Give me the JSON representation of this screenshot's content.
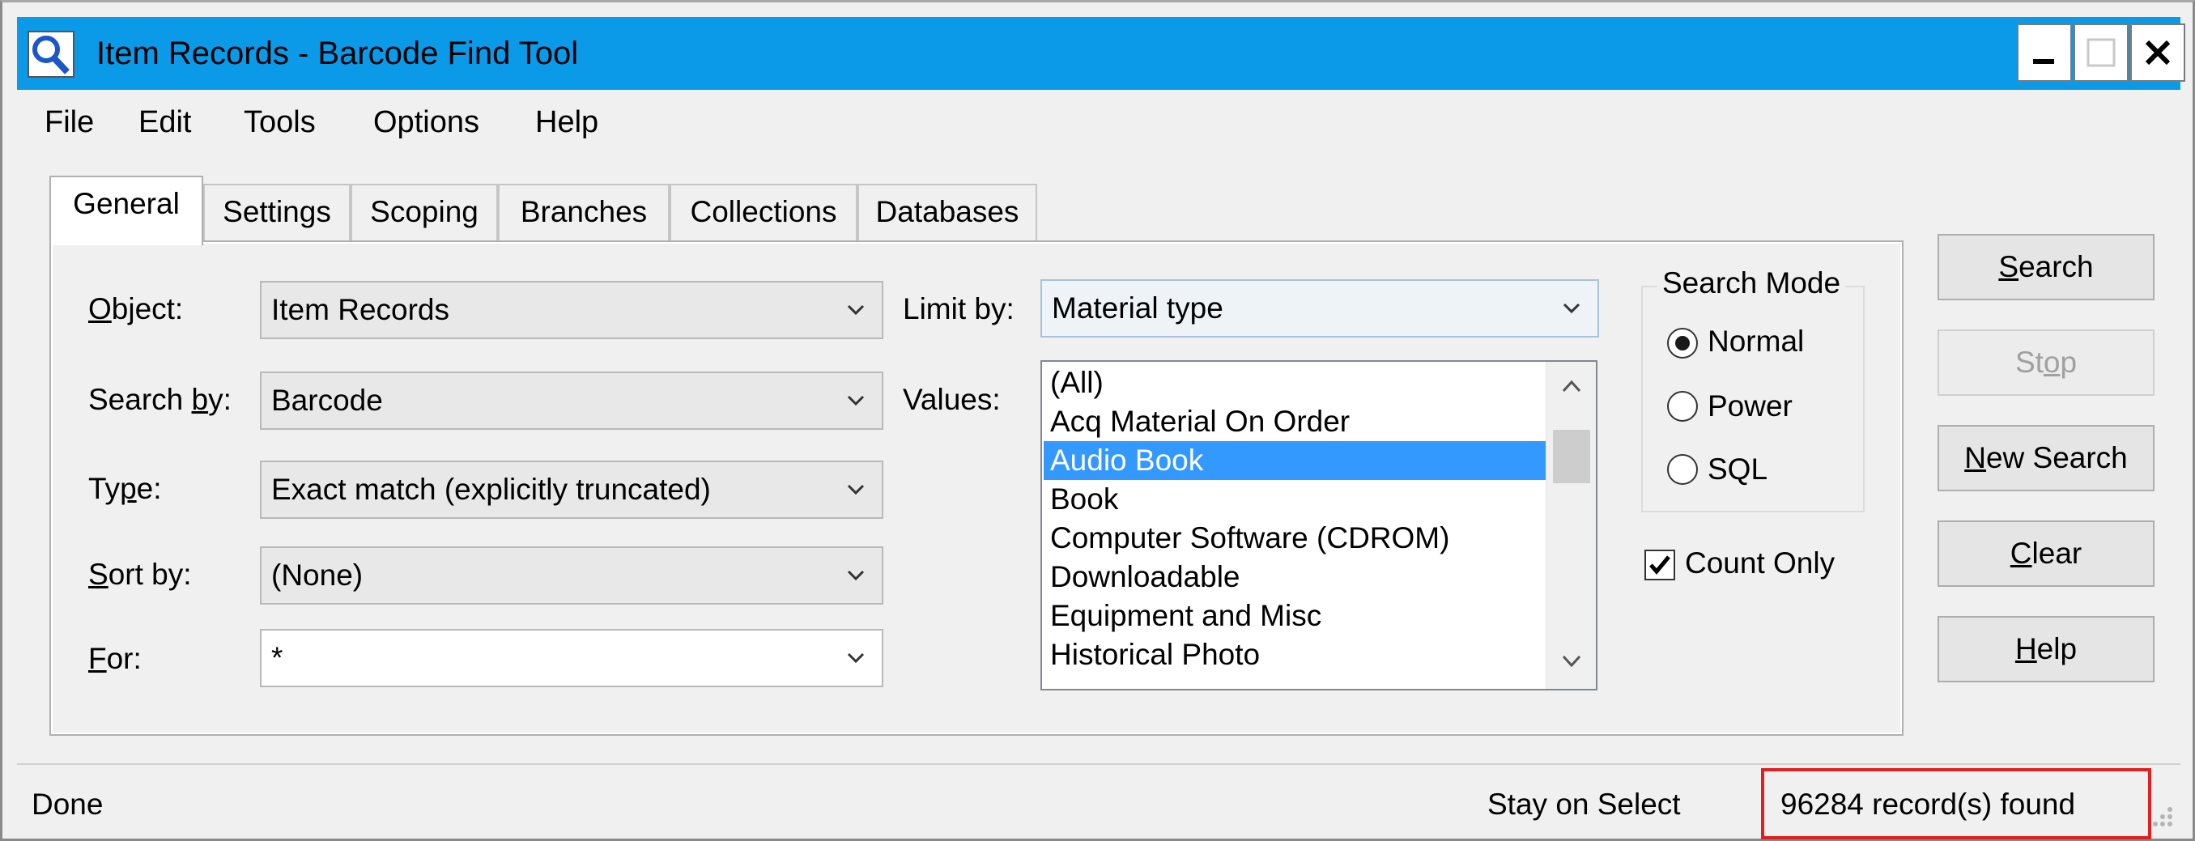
{
  "window": {
    "title": "Item Records - Barcode Find Tool",
    "buttons": {
      "minimize": "_",
      "close": "✕"
    }
  },
  "menu": {
    "file": "File",
    "edit": "Edit",
    "tools": "Tools",
    "options": "Options",
    "help": "Help"
  },
  "tabs": [
    "General",
    "Settings",
    "Scoping",
    "Branches",
    "Collections",
    "Databases"
  ],
  "form": {
    "object": {
      "label_u": "O",
      "label_rest": "bject:",
      "value": "Item Records"
    },
    "search_by": {
      "label_pre": "Search ",
      "label_u": "b",
      "label_rest": "y:",
      "value": "Barcode"
    },
    "type": {
      "label_pre": "Ty",
      "label_u": "p",
      "label_rest": "e:",
      "value": "Exact match (explicitly truncated)"
    },
    "sort_by": {
      "label_u": "S",
      "label_rest": "ort by:",
      "value": "(None)"
    },
    "for": {
      "label_u": "F",
      "label_rest": "or:",
      "value": "*"
    },
    "limit_by": {
      "label": "Limit by:",
      "value": "Material type"
    },
    "values": {
      "label": "Values:",
      "items": [
        "(All)",
        "Acq Material On Order",
        "Audio Book",
        "Book",
        "Computer Software (CDROM)",
        "Downloadable",
        "Equipment and Misc",
        "Historical Photo"
      ],
      "selected_index": 2
    }
  },
  "search_mode": {
    "title": "Search Mode",
    "options": [
      "Normal",
      "Power",
      "SQL"
    ],
    "selected": "Normal"
  },
  "count_only": {
    "label": "Count Only",
    "checked": true
  },
  "buttons": {
    "search": {
      "u": "S",
      "rest": "earch"
    },
    "stop": {
      "pre": "St",
      "u": "o",
      "rest": "p"
    },
    "new_search": {
      "u": "N",
      "rest": "ew Search"
    },
    "clear": {
      "u": "C",
      "rest": "lear"
    },
    "help": {
      "u": "H",
      "rest": "elp"
    }
  },
  "status": {
    "left": "Done",
    "middle": "Stay on Select",
    "right": "96284 record(s) found"
  },
  "colors": {
    "titlebar": "#0b9ae8",
    "selection": "#3399ff",
    "highlight": "#e02020"
  }
}
